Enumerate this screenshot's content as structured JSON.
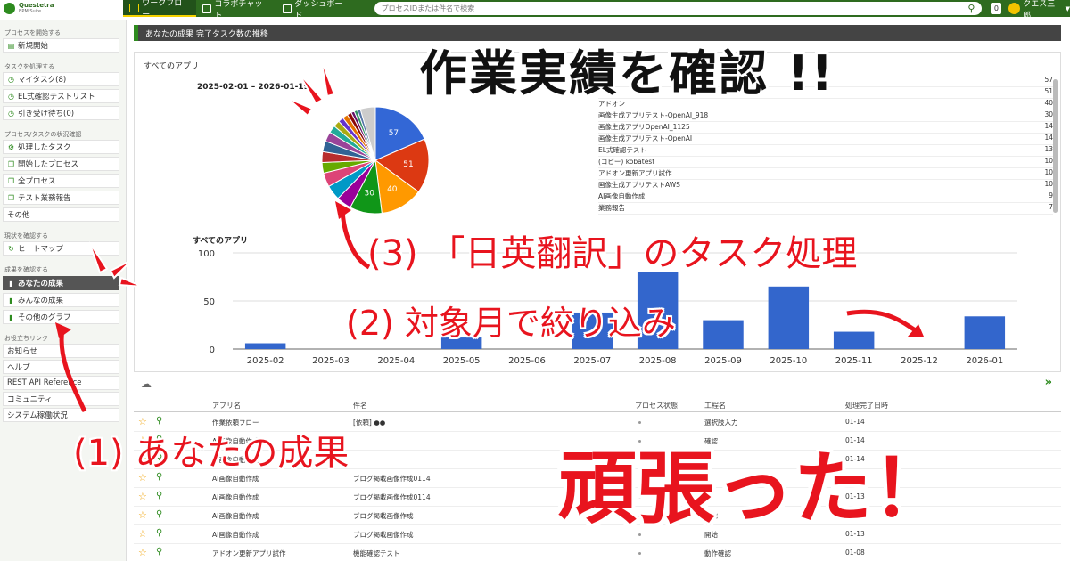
{
  "app": {
    "logo_name": "Questetra",
    "logo_sub": "BPM Suite",
    "nav": [
      {
        "label": "ワークフロー",
        "active": true
      },
      {
        "label": "コラボチャット",
        "active": false
      },
      {
        "label": "ダッシュボード",
        "active": false
      }
    ],
    "search_placeholder": "プロセスIDまたは件名で検索",
    "notification_count": "0",
    "user_name": "クエス三郎"
  },
  "sidebar": {
    "sections": [
      {
        "title": "プロセスを開始する",
        "items": [
          {
            "label": "新規開始",
            "icon": "document-icon"
          }
        ]
      },
      {
        "title": "タスクを処理する",
        "items": [
          {
            "label": "マイタスク(8)",
            "icon": "clock-icon"
          },
          {
            "label": "EL式確認テストリスト",
            "icon": "clock-icon"
          },
          {
            "label": "引き受け待ち(0)",
            "icon": "clock-icon"
          }
        ]
      },
      {
        "title": "プロセス/タスクの状況確認",
        "items": [
          {
            "label": "処理したタスク",
            "icon": "process-icon"
          },
          {
            "label": "開始したプロセス",
            "icon": "copy-icon"
          },
          {
            "label": "全プロセス",
            "icon": "copy-icon"
          },
          {
            "label": "テスト業務報告",
            "icon": "copy-icon"
          },
          {
            "label": "その他",
            "icon": ""
          }
        ]
      },
      {
        "title": "現状を確認する",
        "items": [
          {
            "label": "ヒートマップ",
            "icon": "refresh-icon"
          }
        ]
      },
      {
        "title": "成果を確認する",
        "items": [
          {
            "label": "あなたの成果",
            "icon": "bar-chart-icon",
            "active": true
          },
          {
            "label": "みんなの成果",
            "icon": "bar-chart-icon"
          },
          {
            "label": "その他のグラフ",
            "icon": "bar-chart-icon"
          }
        ]
      },
      {
        "title": "お役立ちリンク",
        "items": [
          {
            "label": "お知らせ",
            "icon": ""
          },
          {
            "label": "ヘルプ",
            "icon": ""
          },
          {
            "label": "REST API Reference",
            "icon": ""
          },
          {
            "label": "コミュニティ",
            "icon": ""
          },
          {
            "label": "システム稼働状況",
            "icon": ""
          }
        ]
      }
    ]
  },
  "main": {
    "page_title": "あなたの成果 完了タスク数の推移",
    "panel_title": "すべてのアプリ",
    "date_range": "2025-02-01 – 2026-01-19",
    "legend_rows": [
      {
        "name": "",
        "value": "57"
      },
      {
        "name": "",
        "value": "51"
      },
      {
        "name": "アドオン",
        "value": "40"
      },
      {
        "name": "画像生成アプリテスト-OpenAI_918",
        "value": "30"
      },
      {
        "name": "画像生成アプリOpenAI_1125",
        "value": "14"
      },
      {
        "name": "画像生成アプリテスト-OpenAI",
        "value": "14"
      },
      {
        "name": "EL式確認テスト",
        "value": "13"
      },
      {
        "name": "(コピー) kobatest",
        "value": "10"
      },
      {
        "name": "アドオン更新アプリ試作",
        "value": "10"
      },
      {
        "name": "画像生成アプリテストAWS",
        "value": "10"
      },
      {
        "name": "AI画像自動作成",
        "value": "9"
      },
      {
        "name": "業務報告",
        "value": "7"
      }
    ],
    "table": {
      "headers": [
        "アプリ名",
        "件名",
        "プロセス状態",
        "工程名",
        "処理完了日時"
      ],
      "rows": [
        [
          "作業依頼フロー",
          "[依頼] ●●",
          "選択肢入力",
          "01-14"
        ],
        [
          "AI画像自動作成",
          "",
          "確認",
          "01-14"
        ],
        [
          "AI画像自動作成",
          "",
          "",
          "01-14"
        ],
        [
          "AI画像自動作成",
          "ブログ掲載画像作成0114",
          "",
          "01-14"
        ],
        [
          "AI画像自動作成",
          "ブログ掲載画像作成0114",
          "",
          "01-13"
        ],
        [
          "AI画像自動作成",
          "ブログ掲載画像作成",
          "確認",
          "01-13"
        ],
        [
          "AI画像自動作成",
          "ブログ掲載画像作成",
          "開始",
          "01-13"
        ],
        [
          "アドオン更新アプリ試作",
          "機能確認テスト",
          "動作確認",
          "01-08"
        ]
      ]
    }
  },
  "chart_data": [
    {
      "type": "pie",
      "title": "",
      "values": [
        57,
        51,
        40,
        30,
        14,
        14,
        13,
        10,
        10,
        10,
        9,
        7,
        6,
        5,
        5,
        4,
        3,
        3,
        3,
        14
      ],
      "data_labels": [
        "57",
        "51",
        "40",
        "30"
      ],
      "colors": [
        "#3367d6",
        "#dc3912",
        "#ff9900",
        "#109618",
        "#990099",
        "#0099c6",
        "#dd4477",
        "#66aa00",
        "#b82e2e",
        "#316395",
        "#994499",
        "#22aa99",
        "#aaaa11",
        "#6633cc",
        "#e67300",
        "#8b0707",
        "#651067",
        "#329262",
        "#5574a6",
        "#cccccc"
      ]
    },
    {
      "type": "bar",
      "title": "すべてのアプリ",
      "categories": [
        "2025-02",
        "2025-03",
        "2025-04",
        "2025-05",
        "2025-06",
        "2025-07",
        "2025-08",
        "2025-09",
        "2025-10",
        "2025-11",
        "2025-12",
        "2026-01"
      ],
      "values": [
        6,
        0,
        0,
        12,
        0,
        38,
        80,
        30,
        65,
        18,
        0,
        34
      ],
      "ylim": [
        0,
        100
      ],
      "yticks": [
        0,
        50,
        100
      ],
      "color": "#3366cc"
    }
  ],
  "overlays": {
    "headline": "作業実績を確認 !!",
    "step3": "(3) 「日英翻訳」のタスク処理",
    "step2": "(2) 対象月で絞り込み",
    "step1": "(1) あなたの成果",
    "cheer": "頑張った！"
  }
}
